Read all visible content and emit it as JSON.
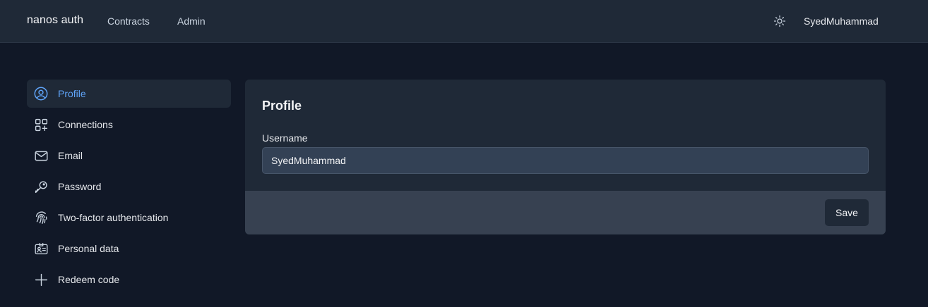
{
  "nav": {
    "brand": "nanos auth",
    "links": [
      {
        "label": "Contracts"
      },
      {
        "label": "Admin"
      }
    ],
    "theme_icon": "sun-icon",
    "user": "SyedMuhammad"
  },
  "sidebar": {
    "items": [
      {
        "label": "Profile",
        "icon": "user-circle-icon",
        "active": true
      },
      {
        "label": "Connections",
        "icon": "squares-plus-icon"
      },
      {
        "label": "Email",
        "icon": "envelope-icon"
      },
      {
        "label": "Password",
        "icon": "key-icon"
      },
      {
        "label": "Two-factor authentication",
        "icon": "fingerprint-icon"
      },
      {
        "label": "Personal data",
        "icon": "identification-icon"
      },
      {
        "label": "Redeem code",
        "icon": "plus-icon"
      }
    ]
  },
  "profile": {
    "title": "Profile",
    "username_label": "Username",
    "username_value": "SyedMuhammad",
    "save_label": "Save"
  },
  "colors": {
    "background": "#111827",
    "surface": "#1f2937",
    "footer": "#374151",
    "accent": "#60a5fa"
  }
}
